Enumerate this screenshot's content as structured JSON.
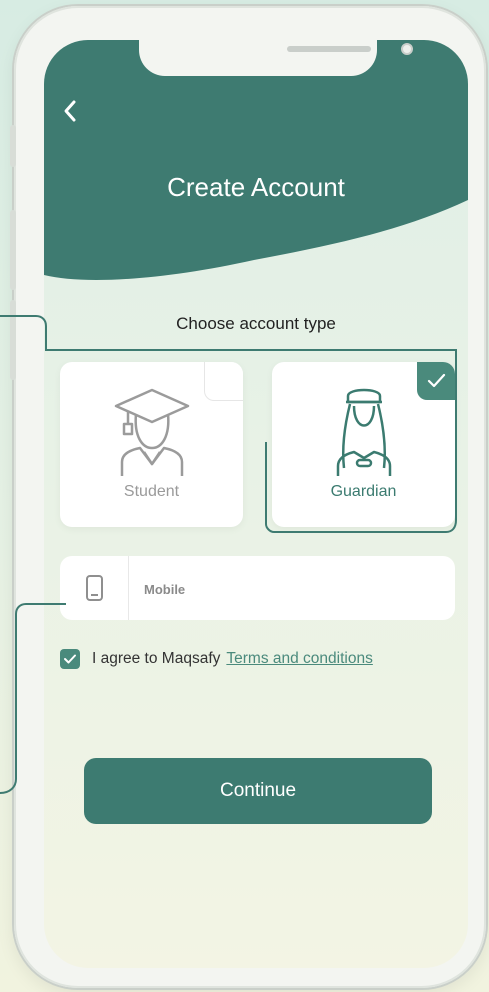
{
  "header": {
    "title": "Create Account",
    "back_icon": "chevron-left-icon"
  },
  "account_type": {
    "prompt": "Choose account type",
    "options": [
      {
        "label": "Student",
        "icon": "graduate-icon",
        "selected": false
      },
      {
        "label": "Guardian",
        "icon": "guardian-icon",
        "selected": true
      }
    ]
  },
  "mobile": {
    "placeholder": "Mobile",
    "value": "",
    "icon": "mobile-phone-icon"
  },
  "agreement": {
    "checked": true,
    "text": "I agree to Maqsafy",
    "link_text": "Terms and conditions"
  },
  "continue_label": "Continue",
  "colors": {
    "accent": "#3d7b71",
    "accent_light": "#4a8a7c",
    "background": "#e3f0e6"
  }
}
